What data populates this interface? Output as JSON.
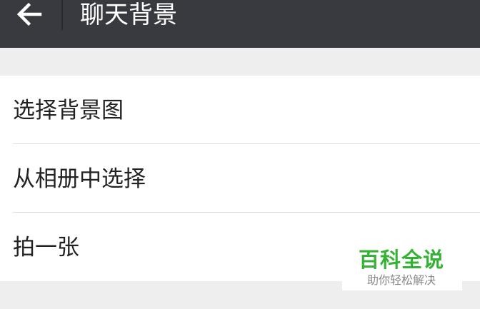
{
  "header": {
    "title": "聊天背景",
    "back_icon": "arrow-left-icon"
  },
  "menu": {
    "items": [
      {
        "label": "选择背景图"
      },
      {
        "label": "从相册中选择"
      },
      {
        "label": "拍一张"
      }
    ]
  },
  "watermark": {
    "title": "百科全说",
    "subtitle": "助你轻松解决"
  },
  "colors": {
    "header_bg": "#393a3f",
    "page_bg": "#eeeeee",
    "watermark_green": "#34b233"
  }
}
